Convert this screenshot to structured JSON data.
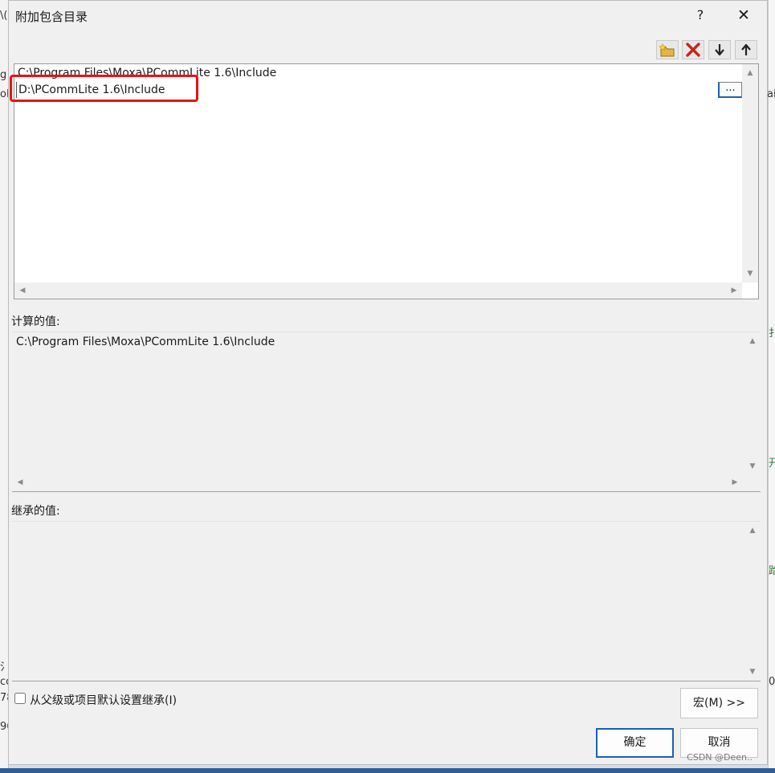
{
  "dialog": {
    "title": "附加包含目录",
    "help_label": "?",
    "close_label": "✕"
  },
  "toolbar": {
    "icons": [
      "new-line-icon",
      "delete-icon",
      "move-down-icon",
      "move-up-icon"
    ]
  },
  "list": {
    "items": [
      "C:\\Program Files\\Moxa\\PCommLite 1.6\\Include"
    ],
    "editing_value": "D:\\PCommLite 1.6\\Include",
    "browse_label": "..."
  },
  "computed": {
    "label": "计算的值:",
    "value": "C:\\Program Files\\Moxa\\PCommLite 1.6\\Include"
  },
  "inherited": {
    "label": "继承的值:",
    "value": ""
  },
  "inherit_checkbox": {
    "label": "从父级或项目默认设置继承(I)",
    "checked": false
  },
  "buttons": {
    "macro": "宏(M) >>",
    "ok": "确定",
    "cancel": "取消"
  },
  "watermark": "CSDN @Deen..",
  "background_fragments": [
    "\\(",
    "g",
    "ol",
    "ai",
    "扌",
    "开",
    "跲",
    "氵",
    "cc",
    "78",
    "96",
    "0"
  ],
  "colors": {
    "highlight": "#e81414",
    "accent": "#1e5fb4",
    "dialog_bg": "#f0f0f0"
  }
}
